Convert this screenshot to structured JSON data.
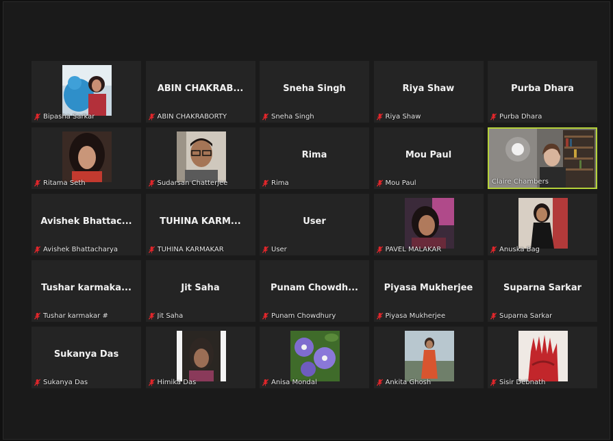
{
  "colors": {
    "background": "#111111",
    "tile": "#242424",
    "active_speaker_border": "#b6d33a",
    "muted_icon": "#e0262b",
    "text": "#f2f2f2"
  },
  "tiles": [
    {
      "display": "",
      "label": "Bipasha Sarkar",
      "video": "photo",
      "muted": true
    },
    {
      "display": "ABIN CHAKRAB...",
      "label": "ABIN CHAKRABORTY",
      "video": "off",
      "muted": true
    },
    {
      "display": "Sneha Singh",
      "label": "Sneha Singh",
      "video": "off",
      "muted": true
    },
    {
      "display": "Riya Shaw",
      "label": "Riya Shaw",
      "video": "off",
      "muted": true
    },
    {
      "display": "Purba Dhara",
      "label": "Purba Dhara",
      "video": "off",
      "muted": true
    },
    {
      "display": "",
      "label": "Ritama Seth",
      "video": "photo",
      "muted": true
    },
    {
      "display": "",
      "label": "Sudarsan Chatterjee",
      "video": "photo",
      "muted": true
    },
    {
      "display": "Rima",
      "label": "Rima",
      "video": "off",
      "muted": true
    },
    {
      "display": "Mou Paul",
      "label": "Mou Paul",
      "video": "off",
      "muted": true
    },
    {
      "display": "",
      "label": "Claire Chambers",
      "video": "live",
      "muted": false,
      "active_speaker": true
    },
    {
      "display": "Avishek Bhattac...",
      "label": "Avishek Bhattacharya",
      "video": "off",
      "muted": true
    },
    {
      "display": "TUHINA KARM...",
      "label": "TUHINA KARMAKAR",
      "video": "off",
      "muted": true
    },
    {
      "display": "User",
      "label": "User",
      "video": "off",
      "muted": true
    },
    {
      "display": "",
      "label": "PAVEL MALAKAR",
      "video": "photo",
      "muted": true
    },
    {
      "display": "",
      "label": "Anuska Bag",
      "video": "photo",
      "muted": true
    },
    {
      "display": "Tushar karmaka...",
      "label": "Tushar karmakar #",
      "video": "off",
      "muted": true
    },
    {
      "display": "Jit Saha",
      "label": "Jit Saha",
      "video": "off",
      "muted": true
    },
    {
      "display": "Punam Chowdh...",
      "label": "Punam Chowdhury",
      "video": "off",
      "muted": true
    },
    {
      "display": "Piyasa Mukherjee",
      "label": "Piyasa Mukherjee",
      "video": "off",
      "muted": true
    },
    {
      "display": "Suparna Sarkar",
      "label": "Suparna Sarkar",
      "video": "off",
      "muted": true
    },
    {
      "display": "Sukanya Das",
      "label": "Sukanya Das",
      "video": "off",
      "muted": true
    },
    {
      "display": "",
      "label": "Himika Das",
      "video": "photo",
      "muted": true
    },
    {
      "display": "",
      "label": "Anisa Mondal",
      "video": "photo",
      "muted": true
    },
    {
      "display": "",
      "label": "Ankita Ghosh",
      "video": "photo",
      "muted": true
    },
    {
      "display": "",
      "label": "Sisir Debnath",
      "video": "photo",
      "muted": true
    }
  ]
}
